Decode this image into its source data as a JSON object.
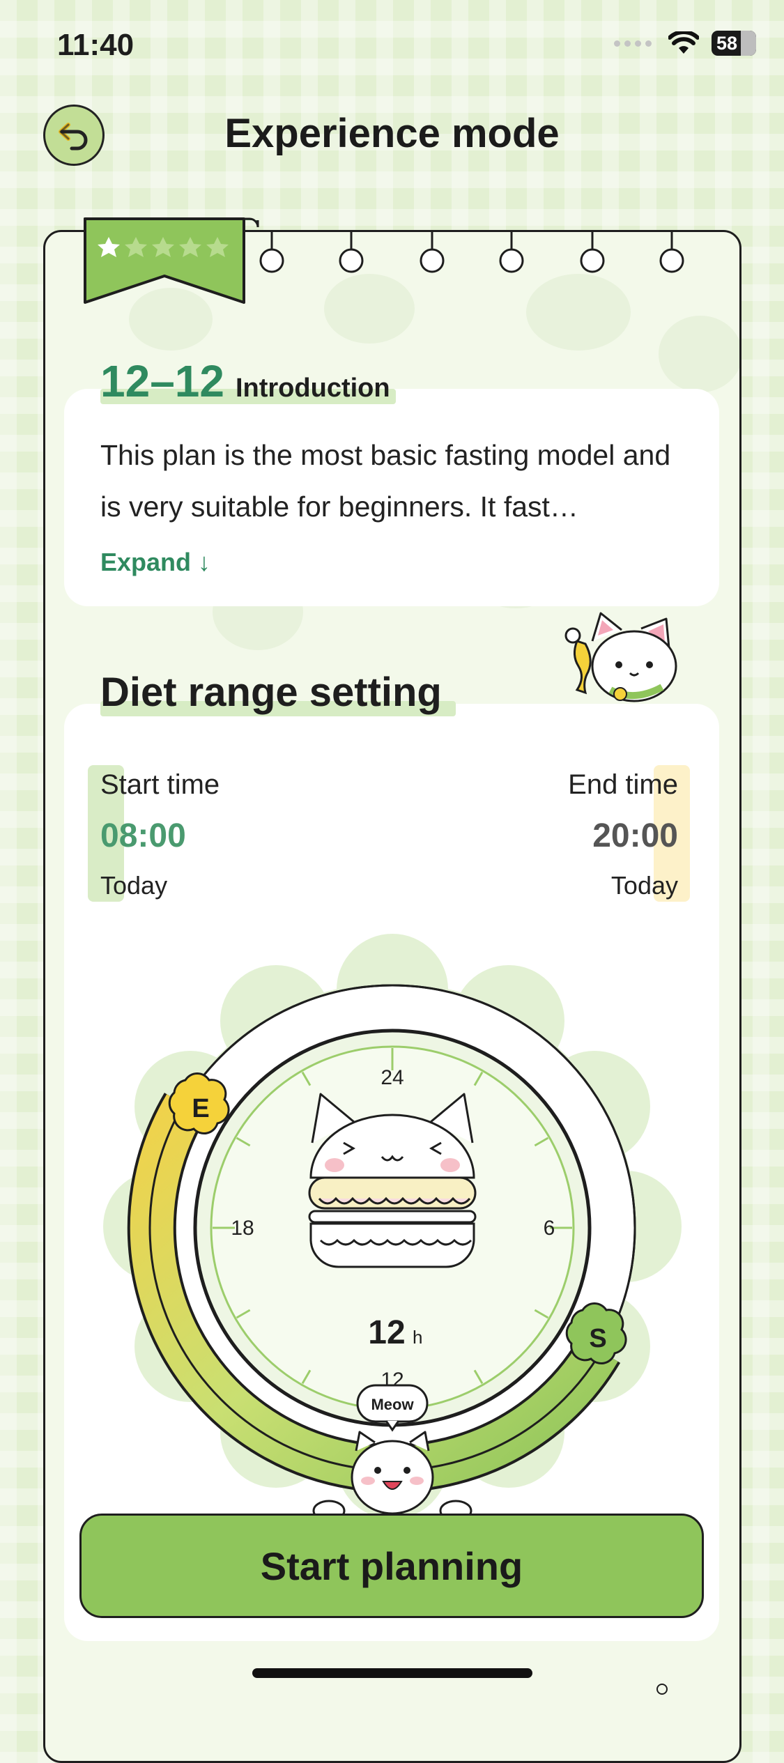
{
  "status_bar": {
    "time": "11:40",
    "battery": "58"
  },
  "header": {
    "title": "Experience mode"
  },
  "intro": {
    "plan_name": "12–12",
    "heading": "Introduction",
    "text": "This plan is the most basic fasting model and is very suitable for beginners. It fast…",
    "expand_label": "Expand ↓"
  },
  "diet": {
    "title": "Diet range setting",
    "start": {
      "label": "Start time",
      "value": "08:00",
      "day": "Today"
    },
    "end": {
      "label": "End time",
      "value": "20:00",
      "day": "Today"
    }
  },
  "dial": {
    "tick_labels": {
      "top": "24",
      "right": "6",
      "bottom": "12",
      "left": "18"
    },
    "duration_value": "12",
    "duration_unit": "h",
    "handle_start": "S",
    "handle_end": "E",
    "speech": "Meow"
  },
  "cta": {
    "label": "Start planning"
  },
  "rating": {
    "filled": 1,
    "total": 5
  },
  "colors": {
    "accent": "#8fc55b",
    "text_accent": "#2f8a5f",
    "end_handle": "#f5d23a"
  }
}
